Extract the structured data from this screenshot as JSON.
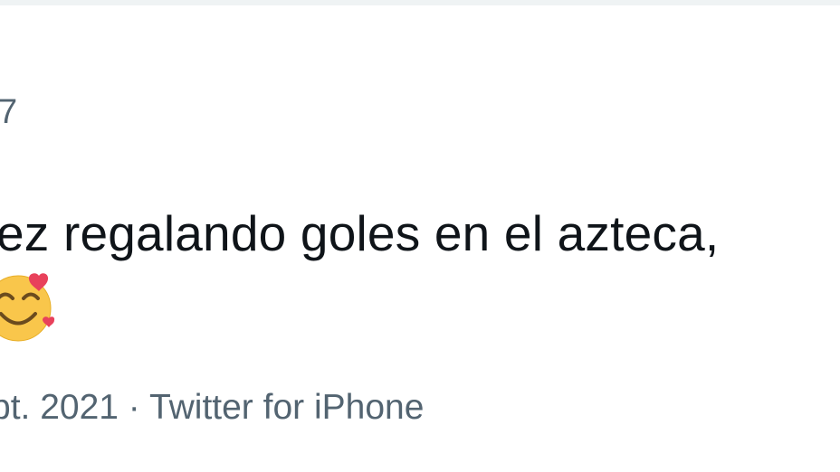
{
  "tweet": {
    "author_fragment": "7",
    "text_line_1": "ez regalando goles en el azteca,",
    "emoji_icon": "smiling-face-with-hearts-icon",
    "date_fragment": "pt. 2021",
    "meta_separator": " · ",
    "source": "Twitter for iPhone"
  },
  "colors": {
    "text_primary": "#0f1419",
    "text_secondary": "#536471",
    "divider": "#eff3f4",
    "emoji_face": "#f9c64b",
    "emoji_heart": "#e8415b"
  }
}
